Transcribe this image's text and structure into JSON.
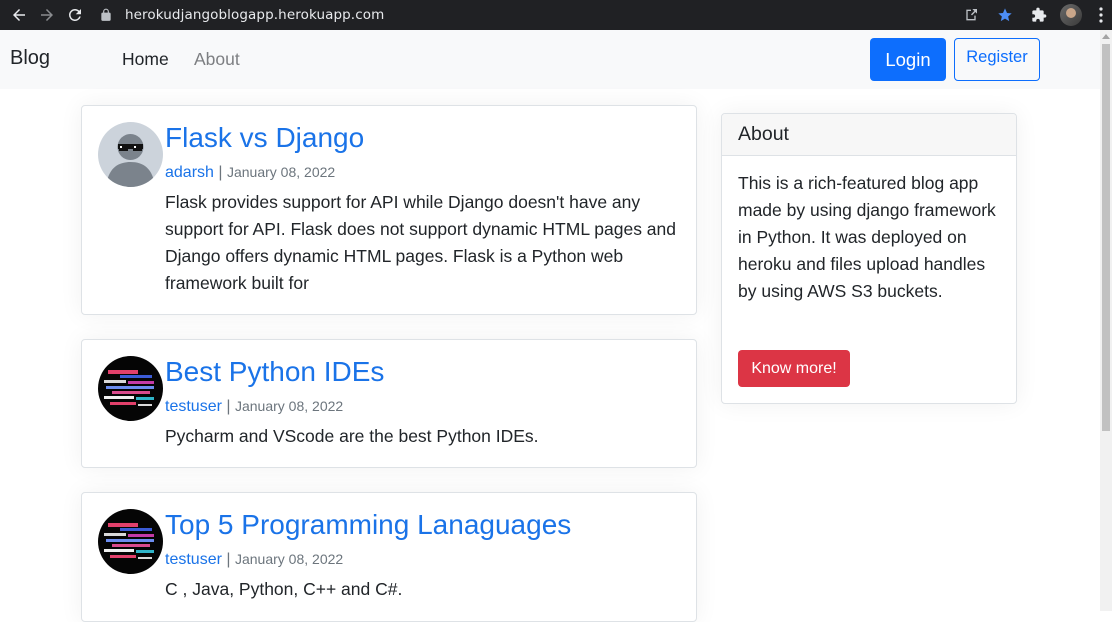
{
  "browser": {
    "url": "herokudjangoblogapp.herokuapp.com"
  },
  "navbar": {
    "brand": "Blog",
    "links": [
      {
        "label": "Home"
      },
      {
        "label": "About"
      }
    ],
    "login_label": "Login",
    "register_label": "Register"
  },
  "posts": [
    {
      "title": "Flask vs Django",
      "author": "adarsh",
      "separator": "|",
      "date": "January 08, 2022",
      "content": "Flask provides support for API while Django doesn't have any support for API. Flask does not support dynamic HTML pages and Django offers dynamic HTML pages. Flask is a Python web framework built for",
      "avatar_icon": "default-avatar-sunglasses-icon"
    },
    {
      "title": "Best Python IDEs",
      "author": "testuser",
      "separator": "|",
      "date": "January 08, 2022",
      "content": "Pycharm and VScode are the best Python IDEs.",
      "avatar_icon": "glitch-avatar-icon"
    },
    {
      "title": "Top 5 Programming Lanaguages",
      "author": "testuser",
      "separator": "|",
      "date": "January 08, 2022",
      "content": "C , Java, Python, C++ and C#.",
      "avatar_icon": "glitch-avatar-icon"
    }
  ],
  "sidebar": {
    "heading": "About",
    "text": "This is a rich-featured blog app made by using django framework in Python. It was deployed on heroku and files upload handles by using AWS S3 buckets.",
    "button_label": "Know more!"
  },
  "colors": {
    "primary": "#0d6efd",
    "link": "#1a73e8",
    "danger": "#dc3545",
    "navbar_bg": "#f8f9fa"
  }
}
